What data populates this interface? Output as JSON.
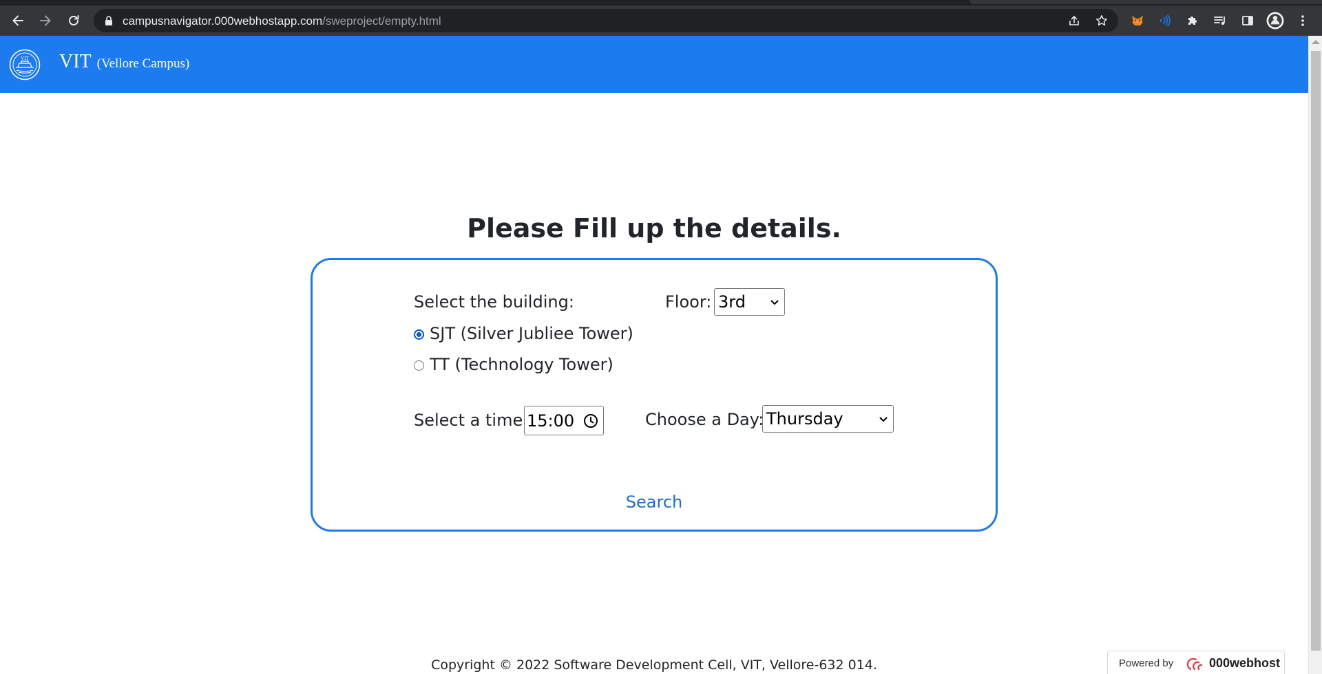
{
  "browser": {
    "url_host": "campusnavigator.000webhostapp.com",
    "url_path": "/sweproject/empty.html"
  },
  "header": {
    "brand": "VIT",
    "subtitle": "(Vellore Campus)",
    "background_color": "#1d7bf0"
  },
  "form": {
    "title": "Please Fill up the details.",
    "building_label": "Select the building:",
    "buildings": [
      {
        "label": "SJT (Silver Jubliee Tower)",
        "checked": true
      },
      {
        "label": "TT (Technology Tower)",
        "checked": false
      }
    ],
    "floor_label": "Floor:",
    "floor_value": "3rd",
    "time_label": "Select a time:",
    "time_value": "15:00",
    "day_label": "Choose a Day:",
    "day_value": "Thursday",
    "search_label": "Search",
    "accent_color": "#1d7bf0"
  },
  "footer": {
    "copyright": "Copyright © 2022 Software Development Cell, VIT, Vellore-632 014."
  },
  "badge": {
    "label": "Powered by",
    "name": "000webhost"
  },
  "icons": {
    "nav": [
      "back-icon",
      "forward-icon",
      "reload-icon"
    ],
    "omnibox": [
      "lock-icon",
      "share-icon",
      "bookmark-star-icon"
    ],
    "extensions": [
      "metamask-fox-icon",
      "read-aloud-icon",
      "puzzle-extensions-icon",
      "media-queue-icon",
      "side-panel-icon",
      "profile-avatar-icon",
      "kebab-menu-icon"
    ]
  }
}
